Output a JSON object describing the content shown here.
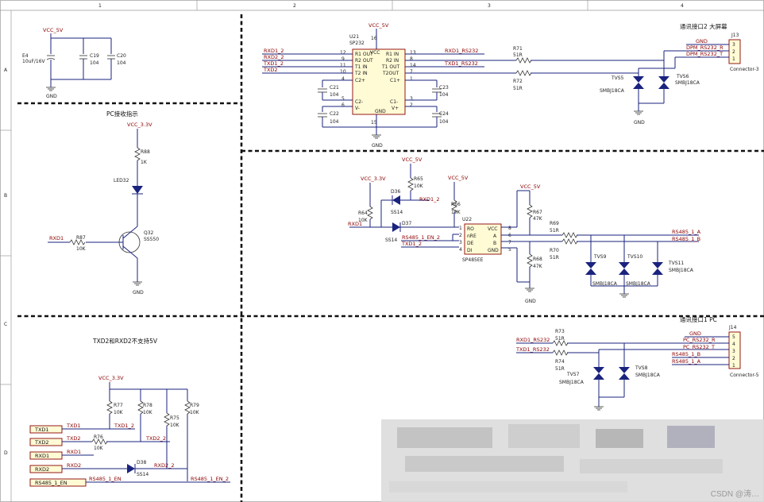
{
  "frame": {
    "columns": [
      "1",
      "2",
      "3",
      "4"
    ],
    "rows": [
      "A",
      "B",
      "C",
      "D"
    ]
  },
  "sections": {
    "power_caps": {
      "net": "VCC_5V",
      "e4_ref": "E4",
      "e4_val": "10uF/16V",
      "c19_ref": "C19",
      "c19_val": "104",
      "c20_ref": "C20",
      "c20_val": "104",
      "gnd": "GND"
    },
    "pc_indicator": {
      "title": "PC接收指示",
      "vcc": "VCC_3.3V",
      "r88_ref": "R88",
      "r88_val": "1K",
      "led_ref": "LED32",
      "q_ref": "Q32",
      "q_val": "SS550",
      "r87_ref": "R87",
      "r87_val": "10K",
      "rx_net": "RXD1",
      "gnd": "GND"
    },
    "sp232": {
      "vcc": "VCC_5V",
      "ref": "U21",
      "part": "SP232",
      "pins_left": [
        "R1 OUT",
        "R2 OUT",
        "T1 IN",
        "T2 IN",
        "C2+",
        "C2-",
        "V-"
      ],
      "pins_left_nums": [
        "12",
        "9",
        "11",
        "10",
        "4",
        "5",
        "6"
      ],
      "pins_right": [
        "R1 IN",
        "R2 IN",
        "T1 OUT",
        "T2OUT",
        "C1+",
        "C1-",
        "V+"
      ],
      "pins_right_nums": [
        "13",
        "8",
        "14",
        "7",
        "1",
        "3",
        "2"
      ],
      "pin_vcc": "VCC",
      "pin_vcc_num": "16",
      "pin_gnd": "GND",
      "pin_gnd_num": "15",
      "left_nets": [
        "RXD1_2",
        "RXD2_2",
        "TXD1_2",
        "TXD2"
      ],
      "right_nets": [
        "RXD1_RS232",
        "TXD1_RS232"
      ],
      "caps": [
        {
          "ref": "C21",
          "val": "104"
        },
        {
          "ref": "C22",
          "val": "104"
        },
        {
          "ref": "C23",
          "val": "104"
        },
        {
          "ref": "C24",
          "val": "104"
        }
      ],
      "r71_ref": "R71",
      "r71_val": "51R",
      "r72_ref": "R72",
      "r72_val": "51R",
      "gnd": "GND"
    },
    "port2": {
      "title": "通讯接口2 大屏幕",
      "ref": "J13",
      "part": "Connector-3",
      "pins": [
        "3",
        "2",
        "1"
      ],
      "nets": [
        "GND",
        "DPM_RS232_R",
        "DPM_RS232_T"
      ],
      "tvs5_ref": "TVS5",
      "tvs5_val": "SMBJ18CA",
      "tvs6_ref": "TVS6",
      "tvs6_val": "SMBJ18CA",
      "gnd": "GND"
    },
    "rs485": {
      "vcc5": "VCC_5V",
      "vcc33": "VCC_3.3V",
      "r65_ref": "R65",
      "r65_val": "10K",
      "r64_ref": "R64",
      "r64_val": "10K",
      "r66_ref": "R66",
      "r66_val": "10K",
      "d36_ref": "D36",
      "d36_val": "SS14",
      "d37_ref": "D37",
      "d37_val": "SS14",
      "rxd1_2": "RXD1_2",
      "rxd1": "RXD1",
      "en_net": "RS485_1_EN_2",
      "txd_net": "TXD1_2",
      "u_ref": "U22",
      "u_part": "SP485EE",
      "u_pins_left": [
        "RO",
        "nRE",
        "DE",
        "DI"
      ],
      "u_pins_left_nums": [
        "1",
        "2",
        "3",
        "4"
      ],
      "u_pins_right": [
        "VCC",
        "A",
        "B",
        "GND"
      ],
      "u_pins_right_nums": [
        "8",
        "6",
        "7",
        "5"
      ],
      "r67_ref": "R67",
      "r67_val": "47K",
      "r68_ref": "R68",
      "r68_val": "47K",
      "r69_ref": "R69",
      "r69_val": "51R",
      "r70_ref": "R70",
      "r70_val": "51R",
      "out_a": "RS485_1_A",
      "out_b": "RS485_1_B",
      "tvs9_ref": "TVS9",
      "tvs9_val": "SMBJ18CA",
      "tvs10_ref": "TVS10",
      "tvs10_val": "SMBJ18CA",
      "tvs11_ref": "TVS11",
      "tvs11_val": "SMBJ18CA",
      "gnd": "GND"
    },
    "port1": {
      "title": "通讯接口1 PC",
      "ref": "J14",
      "part": "Connector-5",
      "pins": [
        "5",
        "4",
        "3",
        "2",
        "1"
      ],
      "nets": [
        "GND",
        "PC_RS232_R",
        "PC_RS232_T",
        "RS485_1_B",
        "RS485_1_A"
      ],
      "r73_ref": "R73",
      "r73_val": "51R",
      "r74_ref": "R74",
      "r74_val": "51R",
      "in_rxd": "RXD1_RS232",
      "in_txd": "TXD1_RS232",
      "tvs7_ref": "TVS7",
      "tvs7_val": "SMBJ18CA",
      "tvs8_ref": "TVS8",
      "tvs8_val": "SMBJ18CA"
    },
    "level_shift": {
      "title": "TXD2和RXD2不支持5V",
      "vcc": "VCC_3.3V",
      "ports": [
        "TXD1",
        "TXD2",
        "RXD1",
        "RXD2",
        "RS485_1_EN"
      ],
      "nets": [
        "TXD1_2",
        "TXD2_2",
        "RXD2_2",
        "RS485_1_EN_2"
      ],
      "wire_labels": [
        "TXD1",
        "TXD2",
        "RXD1",
        "RXD2",
        "RS485_1_EN"
      ],
      "r77_ref": "R77",
      "r77_val": "10K",
      "r78_ref": "R78",
      "r78_val": "10K",
      "r75_ref": "R75",
      "r75_val": "10K",
      "r79_ref": "R79",
      "r79_val": "10K",
      "r76_ref": "R76",
      "r76_val": "10K",
      "d38_ref": "D38",
      "d38_val": "SS14"
    }
  },
  "watermark": "CSDN @涛…"
}
